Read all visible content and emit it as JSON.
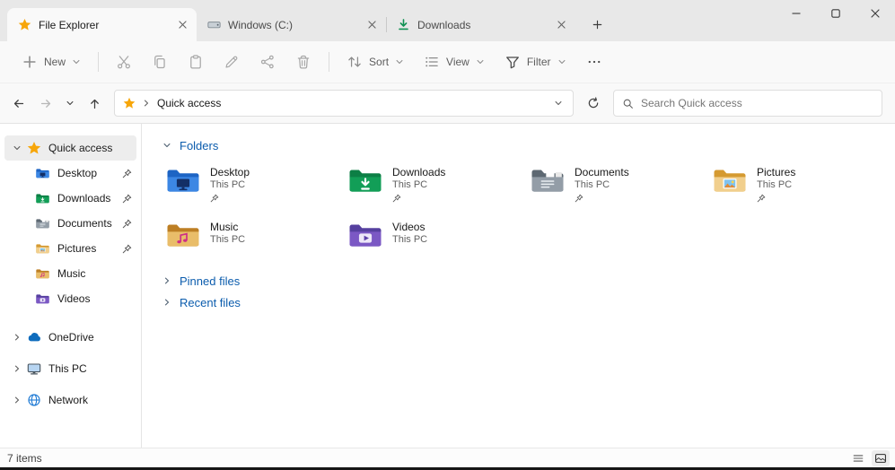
{
  "tabs": {
    "items": [
      {
        "label": "File Explorer",
        "icon": "quick-access-star",
        "active": true
      },
      {
        "label": "Windows (C:)",
        "icon": "drive",
        "active": false
      },
      {
        "label": "Downloads",
        "icon": "download-arrow",
        "active": false
      }
    ],
    "new_tab_icon": "plus"
  },
  "window_controls": {
    "icons": [
      "minimize",
      "maximize",
      "close"
    ]
  },
  "toolbar": {
    "new_label": "New",
    "sort_label": "Sort",
    "view_label": "View",
    "filter_label": "Filter",
    "icon_buttons": [
      "cut",
      "copy",
      "paste",
      "rename",
      "share",
      "delete"
    ],
    "more_icon": "ellipsis"
  },
  "address": {
    "breadcrumb_root": "Quick access",
    "breadcrumb_icon": "quick-access-star",
    "search_placeholder": "Search Quick access",
    "nav_icons": [
      "back-arrow",
      "forward-arrow",
      "history-chevron",
      "up-arrow",
      "refresh"
    ]
  },
  "sidebar": {
    "quick_access_label": "Quick access",
    "quick_access_items": [
      {
        "label": "Desktop",
        "icon": "desktop-folder",
        "pinned": true
      },
      {
        "label": "Downloads",
        "icon": "downloads-folder",
        "pinned": true
      },
      {
        "label": "Documents",
        "icon": "documents-folder",
        "pinned": true
      },
      {
        "label": "Pictures",
        "icon": "pictures-folder",
        "pinned": true
      },
      {
        "label": "Music",
        "icon": "music-folder",
        "pinned": false
      },
      {
        "label": "Videos",
        "icon": "videos-folder",
        "pinned": false
      }
    ],
    "roots": [
      {
        "label": "OneDrive",
        "icon": "onedrive-cloud"
      },
      {
        "label": "This PC",
        "icon": "computer"
      },
      {
        "label": "Network",
        "icon": "network-globe"
      }
    ]
  },
  "main": {
    "sections": {
      "folders": {
        "label": "Folders",
        "expanded": true
      },
      "pinned_files": {
        "label": "Pinned files",
        "expanded": false
      },
      "recent_files": {
        "label": "Recent files",
        "expanded": false
      }
    },
    "folder_tiles": [
      {
        "name": "Desktop",
        "location": "This PC",
        "icon": "desktop-folder",
        "pinned": true
      },
      {
        "name": "Downloads",
        "location": "This PC",
        "icon": "downloads-folder",
        "pinned": true
      },
      {
        "name": "Documents",
        "location": "This PC",
        "icon": "documents-folder",
        "pinned": true
      },
      {
        "name": "Pictures",
        "location": "This PC",
        "icon": "pictures-folder",
        "pinned": true
      },
      {
        "name": "Music",
        "location": "This PC",
        "icon": "music-folder",
        "pinned": false
      },
      {
        "name": "Videos",
        "location": "This PC",
        "icon": "videos-folder",
        "pinned": false
      }
    ]
  },
  "status_bar": {
    "item_count": "7 items",
    "view_toggle_icons": [
      "details-view",
      "large-thumbnails-view"
    ]
  },
  "colors": {
    "accent_header": "#0b5cad",
    "chrome_bg": "#e8e8e8",
    "surface_bg": "#f9f9f9"
  }
}
